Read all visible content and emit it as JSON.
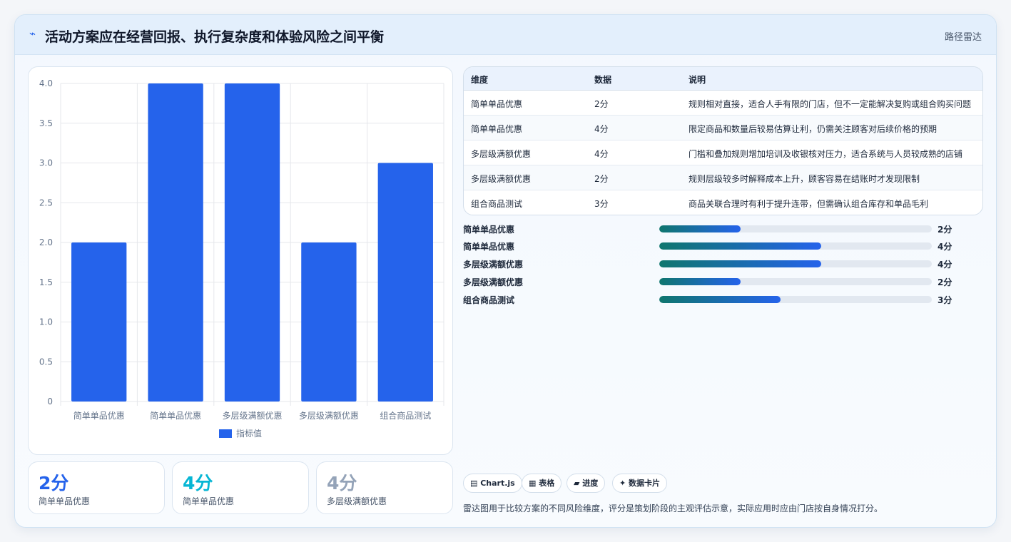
{
  "header": {
    "icon": "bolt-icon",
    "title": "活动方案应在经营回报、执行复杂度和体验风险之间平衡",
    "tag": "路径雷达"
  },
  "chart_data": {
    "type": "bar",
    "categories": [
      "简单单品优惠",
      "简单单品优惠",
      "多层级满额优惠",
      "多层级满额优惠",
      "组合商品测试"
    ],
    "series": [
      {
        "name": "指标值",
        "values": [
          2,
          4,
          4,
          2,
          3
        ],
        "color": "#2563eb"
      }
    ],
    "ylim": [
      0,
      4
    ],
    "yticks": [
      "0",
      "0.5",
      "1.0",
      "1.5",
      "2.0",
      "2.5",
      "3.0",
      "3.5",
      "4.0"
    ],
    "grid": true,
    "legend": "bottom"
  },
  "stats": [
    {
      "value": "2分",
      "label": "简单单品优惠",
      "color": "#2563eb"
    },
    {
      "value": "4分",
      "label": "简单单品优惠",
      "color": "#06b6d4"
    },
    {
      "value": "4分",
      "label": "多层级满额优惠",
      "color": "#94a3b8"
    }
  ],
  "table": {
    "headers": [
      "维度",
      "数据",
      "说明"
    ],
    "rows": [
      [
        "简单单品优惠",
        "2分",
        "规则相对直接，适合人手有限的门店，但不一定能解决复购或组合购买问题"
      ],
      [
        "简单单品优惠",
        "4分",
        "限定商品和数量后较易估算让利，仍需关注顾客对后续价格的预期"
      ],
      [
        "多层级满额优惠",
        "4分",
        "门槛和叠加规则增加培训及收银核对压力，适合系统与人员较成熟的店铺"
      ],
      [
        "多层级满额优惠",
        "2分",
        "规则层级较多时解释成本上升，顾客容易在结账时才发现限制"
      ],
      [
        "组合商品测试",
        "3分",
        "商品关联合理时有利于提升连带，但需确认组合库存和单品毛利"
      ]
    ]
  },
  "progress": [
    {
      "label": "简单单品优惠",
      "value": 2,
      "max": 4,
      "text": "2分"
    },
    {
      "label": "简单单品优惠",
      "value": 4,
      "max": 4,
      "text": "4分"
    },
    {
      "label": "多层级满额优惠",
      "value": 4,
      "max": 4,
      "text": "4分"
    },
    {
      "label": "多层级满额优惠",
      "value": 2,
      "max": 4,
      "text": "2分"
    },
    {
      "label": "组合商品测试",
      "value": 3,
      "max": 4,
      "text": "3分"
    }
  ],
  "pills": [
    "▤ Chart.js",
    "▦ 表格",
    "▰ 进度",
    "✦ 数据卡片"
  ],
  "note": "雷达图用于比较方案的不同风险维度，评分是策划阶段的主观评估示意，实际应用时应由门店按自身情况打分。"
}
